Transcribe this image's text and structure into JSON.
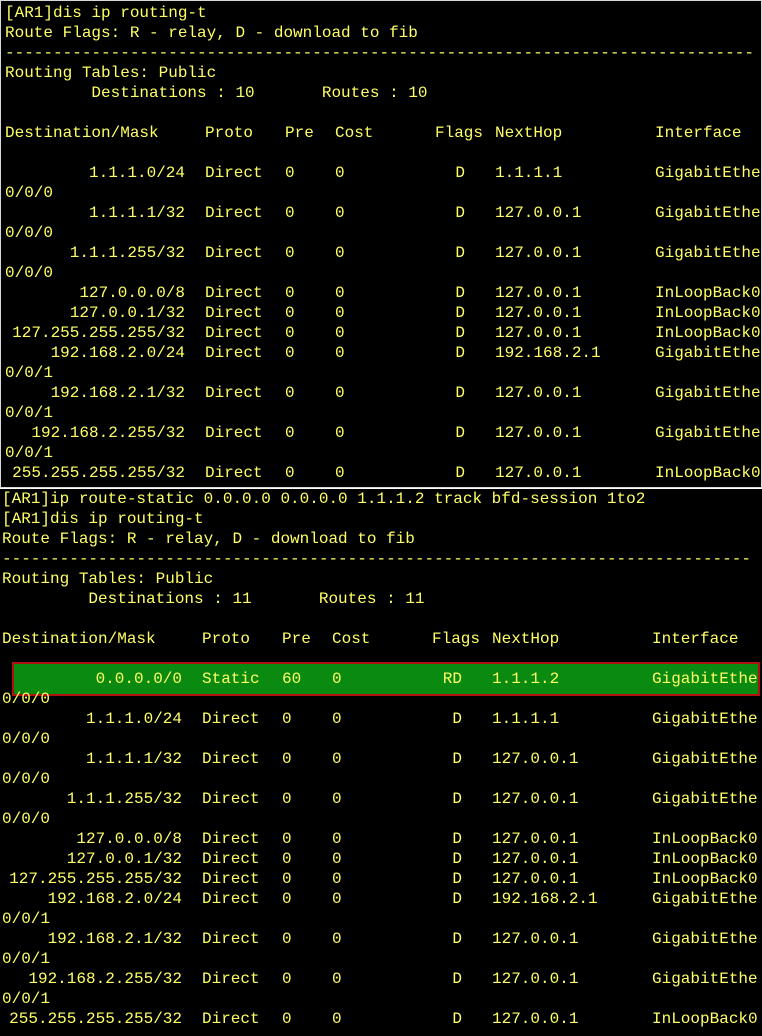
{
  "terminal1": {
    "lines_before": [
      "[AR1]dis ip routing-t",
      "Route Flags: R - relay, D - download to fib",
      "------------------------------------------------------------------------------",
      "Routing Tables: Public",
      "         Destinations : 10       Routes : 10"
    ],
    "headers": [
      "Destination/Mask",
      "Proto",
      "Pre",
      "Cost",
      "Flags",
      "NextHop",
      "Interface"
    ],
    "rows": [
      {
        "dest": "1.1.1.0/24",
        "proto": "Direct",
        "pre": "0",
        "cost": "0",
        "flags": "D",
        "nexthop": "1.1.1.1",
        "iface": "GigabitEthe",
        "cont": "0/0/0"
      },
      {
        "dest": "1.1.1.1/32",
        "proto": "Direct",
        "pre": "0",
        "cost": "0",
        "flags": "D",
        "nexthop": "127.0.0.1",
        "iface": "GigabitEthe",
        "cont": "0/0/0"
      },
      {
        "dest": "1.1.1.255/32",
        "proto": "Direct",
        "pre": "0",
        "cost": "0",
        "flags": "D",
        "nexthop": "127.0.0.1",
        "iface": "GigabitEthe",
        "cont": "0/0/0"
      },
      {
        "dest": "127.0.0.0/8",
        "proto": "Direct",
        "pre": "0",
        "cost": "0",
        "flags": "D",
        "nexthop": "127.0.0.1",
        "iface": "InLoopBack0",
        "cont": ""
      },
      {
        "dest": "127.0.0.1/32",
        "proto": "Direct",
        "pre": "0",
        "cost": "0",
        "flags": "D",
        "nexthop": "127.0.0.1",
        "iface": "InLoopBack0",
        "cont": ""
      },
      {
        "dest": "127.255.255.255/32",
        "proto": "Direct",
        "pre": "0",
        "cost": "0",
        "flags": "D",
        "nexthop": "127.0.0.1",
        "iface": "InLoopBack0",
        "cont": ""
      },
      {
        "dest": "192.168.2.0/24",
        "proto": "Direct",
        "pre": "0",
        "cost": "0",
        "flags": "D",
        "nexthop": "192.168.2.1",
        "iface": "GigabitEthe",
        "cont": "0/0/1"
      },
      {
        "dest": "192.168.2.1/32",
        "proto": "Direct",
        "pre": "0",
        "cost": "0",
        "flags": "D",
        "nexthop": "127.0.0.1",
        "iface": "GigabitEthe",
        "cont": "0/0/1"
      },
      {
        "dest": "192.168.2.255/32",
        "proto": "Direct",
        "pre": "0",
        "cost": "0",
        "flags": "D",
        "nexthop": "127.0.0.1",
        "iface": "GigabitEthe",
        "cont": "0/0/1"
      },
      {
        "dest": "255.255.255.255/32",
        "proto": "Direct",
        "pre": "0",
        "cost": "0",
        "flags": "D",
        "nexthop": "127.0.0.1",
        "iface": "InLoopBack0",
        "cont": ""
      }
    ]
  },
  "terminal2": {
    "lines_before": [
      "[AR1]ip route-static 0.0.0.0 0.0.0.0 1.1.1.2 track bfd-session 1to2",
      "[AR1]dis ip routing-t",
      "Route Flags: R - relay, D - download to fib",
      "------------------------------------------------------------------------------",
      "Routing Tables: Public",
      "         Destinations : 11       Routes : 11"
    ],
    "headers": [
      "Destination/Mask",
      "Proto",
      "Pre",
      "Cost",
      "Flags",
      "NextHop",
      "Interface"
    ],
    "rows": [
      {
        "dest": "0.0.0.0/0",
        "proto": "Static",
        "pre": "60",
        "cost": "0",
        "flags": "RD",
        "nexthop": "1.1.1.2",
        "iface": "GigabitEthe",
        "cont": "0/0/0",
        "highlight": true
      },
      {
        "dest": "1.1.1.0/24",
        "proto": "Direct",
        "pre": "0",
        "cost": "0",
        "flags": "D",
        "nexthop": "1.1.1.1",
        "iface": "GigabitEthe",
        "cont": "0/0/0"
      },
      {
        "dest": "1.1.1.1/32",
        "proto": "Direct",
        "pre": "0",
        "cost": "0",
        "flags": "D",
        "nexthop": "127.0.0.1",
        "iface": "GigabitEthe",
        "cont": "0/0/0"
      },
      {
        "dest": "1.1.1.255/32",
        "proto": "Direct",
        "pre": "0",
        "cost": "0",
        "flags": "D",
        "nexthop": "127.0.0.1",
        "iface": "GigabitEthe",
        "cont": "0/0/0"
      },
      {
        "dest": "127.0.0.0/8",
        "proto": "Direct",
        "pre": "0",
        "cost": "0",
        "flags": "D",
        "nexthop": "127.0.0.1",
        "iface": "InLoopBack0",
        "cont": ""
      },
      {
        "dest": "127.0.0.1/32",
        "proto": "Direct",
        "pre": "0",
        "cost": "0",
        "flags": "D",
        "nexthop": "127.0.0.1",
        "iface": "InLoopBack0",
        "cont": ""
      },
      {
        "dest": "127.255.255.255/32",
        "proto": "Direct",
        "pre": "0",
        "cost": "0",
        "flags": "D",
        "nexthop": "127.0.0.1",
        "iface": "InLoopBack0",
        "cont": ""
      },
      {
        "dest": "192.168.2.0/24",
        "proto": "Direct",
        "pre": "0",
        "cost": "0",
        "flags": "D",
        "nexthop": "192.168.2.1",
        "iface": "GigabitEthe",
        "cont": "0/0/1"
      },
      {
        "dest": "192.168.2.1/32",
        "proto": "Direct",
        "pre": "0",
        "cost": "0",
        "flags": "D",
        "nexthop": "127.0.0.1",
        "iface": "GigabitEthe",
        "cont": "0/0/1"
      },
      {
        "dest": "192.168.2.255/32",
        "proto": "Direct",
        "pre": "0",
        "cost": "0",
        "flags": "D",
        "nexthop": "127.0.0.1",
        "iface": "GigabitEthe",
        "cont": "0/0/1"
      },
      {
        "dest": "255.255.255.255/32",
        "proto": "Direct",
        "pre": "0",
        "cost": "0",
        "flags": "D",
        "nexthop": "127.0.0.1",
        "iface": "InLoopBack0",
        "cont": ""
      }
    ]
  },
  "colors": {
    "terminal_bg": "#000000",
    "terminal_text": "#ffff66",
    "highlight_bg": "#0a8a10",
    "highlight_border": "#b01010"
  }
}
